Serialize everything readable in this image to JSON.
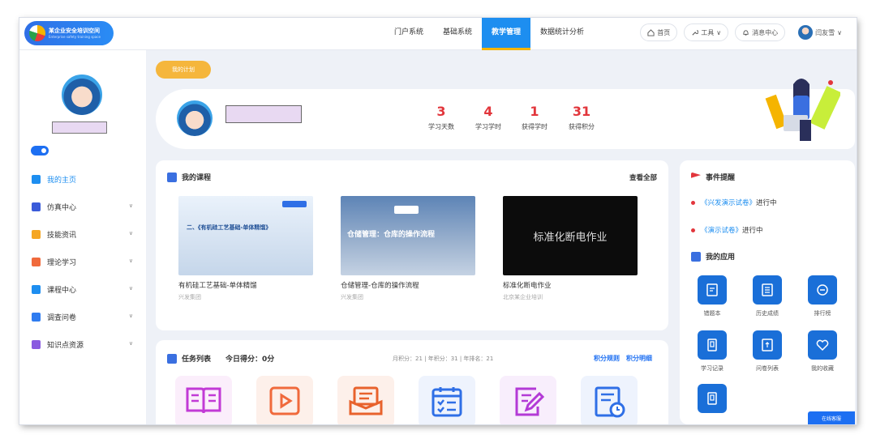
{
  "header": {
    "logo_title": "某企业安全培训空间",
    "logo_subtitle": "Enterprise safety training space",
    "nav": [
      "门户系统",
      "基础系统",
      "教学管理",
      "数据统计分析"
    ],
    "active_nav": "教学管理",
    "home_label": "首页",
    "tools_label": "工具",
    "messages_label": "消息中心",
    "user_name": "闫友雪"
  },
  "sidebar": {
    "items": [
      {
        "label": "我的主页",
        "icon": "home-icon",
        "color": "#1d8ef0"
      },
      {
        "label": "仿真中心",
        "icon": "monitor-icon",
        "color": "#3a5bd9"
      },
      {
        "label": "技能资讯",
        "icon": "news-icon",
        "color": "#f5a623"
      },
      {
        "label": "理论学习",
        "icon": "book-icon",
        "color": "#f06a3c"
      },
      {
        "label": "课程中心",
        "icon": "course-icon",
        "color": "#1d8ef0"
      },
      {
        "label": "调查问卷",
        "icon": "survey-icon",
        "color": "#2f7cf0"
      },
      {
        "label": "知识点资源",
        "icon": "knowledge-icon",
        "color": "#8a5be0"
      }
    ]
  },
  "plan_button": "我的计划",
  "stats": [
    {
      "value": "3",
      "label": "学习天数"
    },
    {
      "value": "4",
      "label": "学习学时"
    },
    {
      "value": "1",
      "label": "获得学时"
    },
    {
      "value": "31",
      "label": "获得积分"
    }
  ],
  "courses_card": {
    "title": "我的课程",
    "view_all": "查看全部",
    "items": [
      {
        "title": "有机硅工艺基础-单体精馏",
        "org": "兴发集团",
        "thumb_text": "二、《有机硅工艺基础-单体精馏》"
      },
      {
        "title": "仓储管理-仓库的操作流程",
        "org": "兴发集团",
        "thumb_text": "仓储管理：仓库的操作流程"
      },
      {
        "title": "标准化断电作业",
        "org": "北京某企业培训",
        "thumb_text": "标准化断电作业"
      }
    ]
  },
  "events_card": {
    "title": "事件提醒",
    "items": [
      {
        "name": "《兴发演示试卷》",
        "status": "进行中"
      },
      {
        "name": "《演示试卷》",
        "status": "进行中"
      }
    ]
  },
  "apps_card": {
    "title": "我的应用",
    "items": [
      {
        "label": "错题本",
        "icon": "notebook-icon"
      },
      {
        "label": "历史成绩",
        "icon": "report-icon"
      },
      {
        "label": "排行榜",
        "icon": "ranking-icon"
      },
      {
        "label": "学习记录",
        "icon": "record-icon"
      },
      {
        "label": "问卷列表",
        "icon": "questionnaire-icon"
      },
      {
        "label": "我的收藏",
        "icon": "heart-icon"
      },
      {
        "label": "",
        "icon": "record-icon"
      }
    ]
  },
  "tasks_card": {
    "title": "任务列表",
    "today_score": "今日得分：0分",
    "summary": "月积分：21 | 年积分：31 | 年排名：21",
    "rules_link": "积分规则",
    "details_link": "积分明细",
    "icons": [
      {
        "icon": "open-book-icon",
        "color": "#c23ad6",
        "bg": "#fbeefb"
      },
      {
        "icon": "video-icon",
        "color": "#f06a3c",
        "bg": "#fdf0ea"
      },
      {
        "icon": "mail-icon",
        "color": "#e8622c",
        "bg": "#fdf0ea"
      },
      {
        "icon": "checklist-icon",
        "color": "#2f6fe6",
        "bg": "#eef3fd"
      },
      {
        "icon": "edit-icon",
        "color": "#b33ad6",
        "bg": "#f8eefc"
      },
      {
        "icon": "schedule-doc-icon",
        "color": "#2f6fe6",
        "bg": "#eef3fd"
      }
    ]
  },
  "help_button": "在线客服"
}
